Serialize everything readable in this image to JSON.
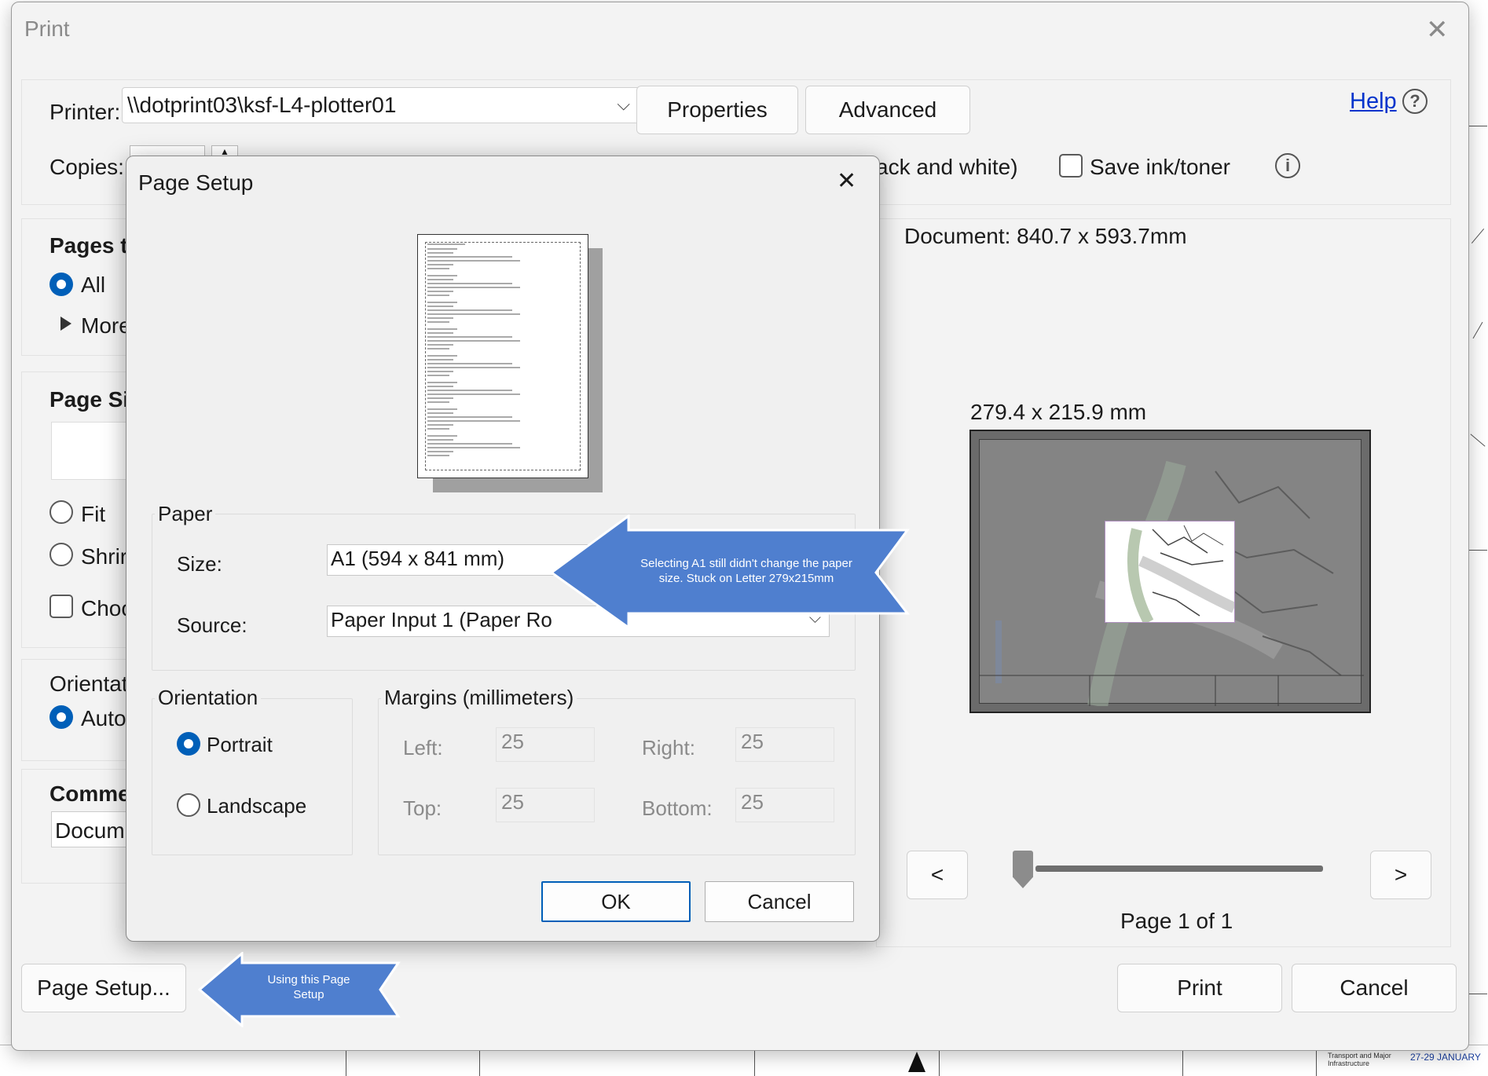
{
  "print_dialog": {
    "title": "Print",
    "printer_label": "Printer:",
    "printer_value": "\\\\dotprint03\\ksf-L4-plotter01",
    "properties_label": "Properties",
    "advanced_label": "Advanced",
    "help_label": "Help",
    "copies_label": "Copies:",
    "bw_label_partial": "ack and white)",
    "save_ink_label": "Save ink/toner",
    "pages_to_print_partial": "Pages to",
    "all_label": "All",
    "more_label": "More",
    "page_size_partial": "Page Siz",
    "fit_partial": "Fit",
    "shrink_partial": "Shrir",
    "choose_partial": "Choo",
    "orientation_partial": "Orientat",
    "auto_partial": "Auto",
    "comments_partial": "Comme",
    "document_partial": "Docum",
    "document_size": "Document: 840.7 x 593.7mm",
    "preview_size": "279.4 x 215.9 mm",
    "prev_label": "<",
    "next_label": ">",
    "page_indicator": "Page 1 of 1",
    "page_setup_button": "Page Setup...",
    "print_button": "Print",
    "cancel_button": "Cancel"
  },
  "page_setup": {
    "title": "Page Setup",
    "paper_group": "Paper",
    "size_label": "Size:",
    "size_value": "A1 (594 x 841 mm)",
    "source_label": "Source:",
    "source_value": "Paper Input 1 (Paper Ro",
    "orientation_group": "Orientation",
    "portrait_label": "Portrait",
    "landscape_label": "Landscape",
    "margins_group": "Margins (millimeters)",
    "left_label": "Left:",
    "left_value": "25",
    "right_label": "Right:",
    "right_value": "25",
    "top_label": "Top:",
    "top_value": "25",
    "bottom_label": "Bottom:",
    "bottom_value": "25",
    "ok_label": "OK",
    "cancel_label": "Cancel"
  },
  "annotations": {
    "callout_size": "Selecting A1 still didn't change the paper size. Stuck on Letter 279x215mm",
    "callout_page_setup": "Using this Page Setup"
  },
  "background": {
    "bottom_right_date": "27-29 JANUARY",
    "bottom_right_org": "Transport and Major Infrastructure"
  },
  "colors": {
    "accent": "#005fb8",
    "callout": "#4f7fcf",
    "link": "#0033cc"
  }
}
